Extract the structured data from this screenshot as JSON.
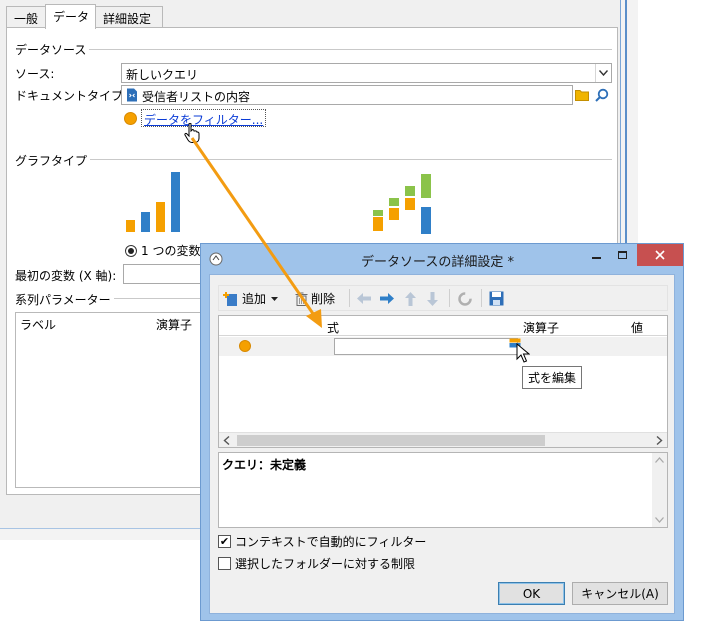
{
  "back_window": {
    "tabs": [
      {
        "label": "一般"
      },
      {
        "label": "データ"
      },
      {
        "label": "詳細設定"
      }
    ],
    "datasource": {
      "title": "データソース",
      "source_label": "ソース:",
      "source_value": "新しいクエリ",
      "doctype_label": "ドキュメントタイプ:",
      "doctype_value": "受信者リストの内容",
      "filter_link": "データをフィルター..."
    },
    "chart_type": {
      "title": "グラフタイプ",
      "option1_label": "1 つの変数"
    },
    "first_var_label": "最初の変数 (X 軸):",
    "series": {
      "title": "系列パラメーター",
      "col_label": "ラベル",
      "col_operator": "演算子"
    }
  },
  "dialog": {
    "title": "データソースの詳細設定 *",
    "toolbar": {
      "add": "追加",
      "delete": "削除"
    },
    "grid": {
      "columns": [
        "式",
        "演算子",
        "値"
      ],
      "row_expr": ""
    },
    "tooltip": "式を編集",
    "query_text": "クエリ：未定義",
    "chk_context": {
      "label": "コンテキストで自動的にフィルター",
      "checked": true
    },
    "chk_folder": {
      "label": "選択したフォルダーに対する制限",
      "checked": false
    },
    "ok": "OK",
    "cancel": "キャンセル(A)"
  },
  "colors": {
    "accent_orange": "#f5a000",
    "bar_blue": "#2f7fc8",
    "bar_green": "#8bc34a",
    "link_blue": "#0a3bd6",
    "dialog_frame": "#9fc3ea",
    "close_red": "#c75050"
  }
}
